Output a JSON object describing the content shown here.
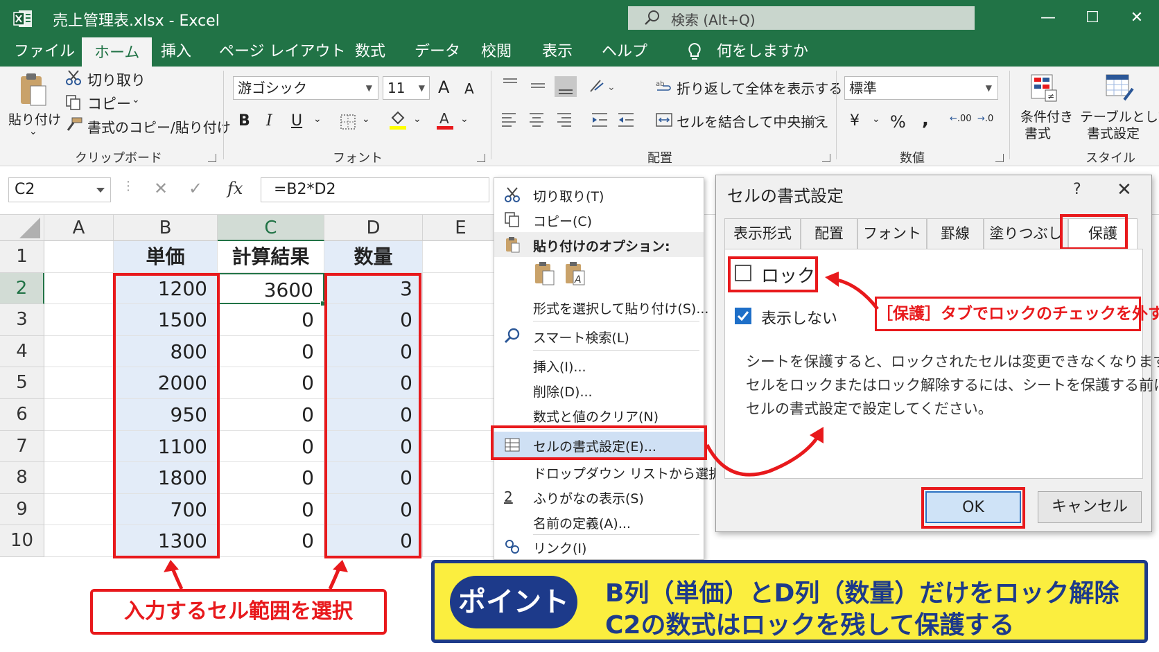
{
  "window": {
    "title": "売上管理表.xlsx  -  Excel",
    "search_placeholder": "検索 (Alt+Q)"
  },
  "menu": {
    "tabs": [
      "ファイル",
      "ホーム",
      "挿入",
      "ページ レイアウト",
      "数式",
      "データ",
      "校閲",
      "表示",
      "ヘルプ"
    ],
    "active": "ホーム",
    "tell_me": "何をしますか"
  },
  "ribbon": {
    "clipboard": {
      "paste": "貼り付け",
      "cut": "切り取り",
      "copy": "コピー",
      "format_painter": "書式のコピー/貼り付け",
      "label": "クリップボード"
    },
    "font": {
      "name": "游ゴシック",
      "size": "11",
      "label": "フォント",
      "bold": "B",
      "italic": "I",
      "underline": "U",
      "grow": "A",
      "shrink": "A"
    },
    "alignment": {
      "wrap": "折り返して全体を表示する",
      "merge": "セルを結合して中央揃え",
      "label": "配置"
    },
    "number": {
      "format": "標準",
      "currency": "¥",
      "percent": "%",
      "comma": ",",
      "inc": ".00",
      "dec": ".0",
      "label": "数値"
    },
    "styles": {
      "conditional": [
        "条件付き",
        "書式"
      ],
      "table": [
        "テーブルとして",
        "書式設定"
      ],
      "label": "スタイル"
    }
  },
  "formula_bar": {
    "name_box": "C2",
    "formula": "=B2*D2",
    "fx": "fx"
  },
  "sheet": {
    "columns": [
      "A",
      "B",
      "C",
      "D",
      "E"
    ],
    "rows": [
      "1",
      "2",
      "3",
      "4",
      "5",
      "6",
      "7",
      "8",
      "9",
      "10"
    ],
    "headers": {
      "B": "単価",
      "C": "計算結果",
      "D": "数量"
    },
    "B": [
      "1200",
      "1500",
      "800",
      "2000",
      "950",
      "1100",
      "1800",
      "700",
      "1300"
    ],
    "C": [
      "3600",
      "0",
      "0",
      "0",
      "0",
      "0",
      "0",
      "0",
      "0"
    ],
    "D": [
      "3",
      "0",
      "0",
      "0",
      "0",
      "0",
      "0",
      "0",
      "0"
    ]
  },
  "context_menu": {
    "cut": "切り取り(T)",
    "copy": "コピー(C)",
    "paste_options": "貼り付けのオプション:",
    "paste_special": "形式を選択して貼り付け(S)...",
    "smart_lookup": "スマート検索(L)",
    "insert": "挿入(I)...",
    "delete": "削除(D)...",
    "clear": "数式と値のクリア(N)",
    "format_cells": "セルの書式設定(E)...",
    "dropdown": "ドロップダウン リストから選択(K)...",
    "furigana": "ふりがなの表示(S)",
    "define_name": "名前の定義(A)...",
    "link": "リンク(I)"
  },
  "dialog": {
    "title": "セルの書式設定",
    "help": "?",
    "close": "✕",
    "tabs": [
      "表示形式",
      "配置",
      "フォント",
      "罫線",
      "塗りつぶし",
      "保護"
    ],
    "active_tab": "保護",
    "lock_label": "ロック",
    "lock_checked": false,
    "hidden_label": "表示しない",
    "hidden_checked": true,
    "note": [
      "シートを保護すると、ロックされたセルは変更できなくなります。",
      "セルをロックまたはロック解除するには、シートを保護する前に、",
      "セルの書式設定で設定してください。"
    ],
    "ok": "OK",
    "cancel": "キャンセル"
  },
  "annotations": {
    "select_range": "入力するセル範囲を選択",
    "uncheck_lock": "［保護］タブでロックのチェックを外す",
    "point_label": "ポイント",
    "point_line1": "B列（単価）とD列（数量）だけをロック解除",
    "point_line2": "C2の数式はロックを残して保護する"
  },
  "colors": {
    "excel_green": "#217346",
    "red": "#e8191c",
    "navy": "#1d3a8a",
    "yellow": "#fbee3f",
    "selection_blue": "#e3ecf8"
  }
}
